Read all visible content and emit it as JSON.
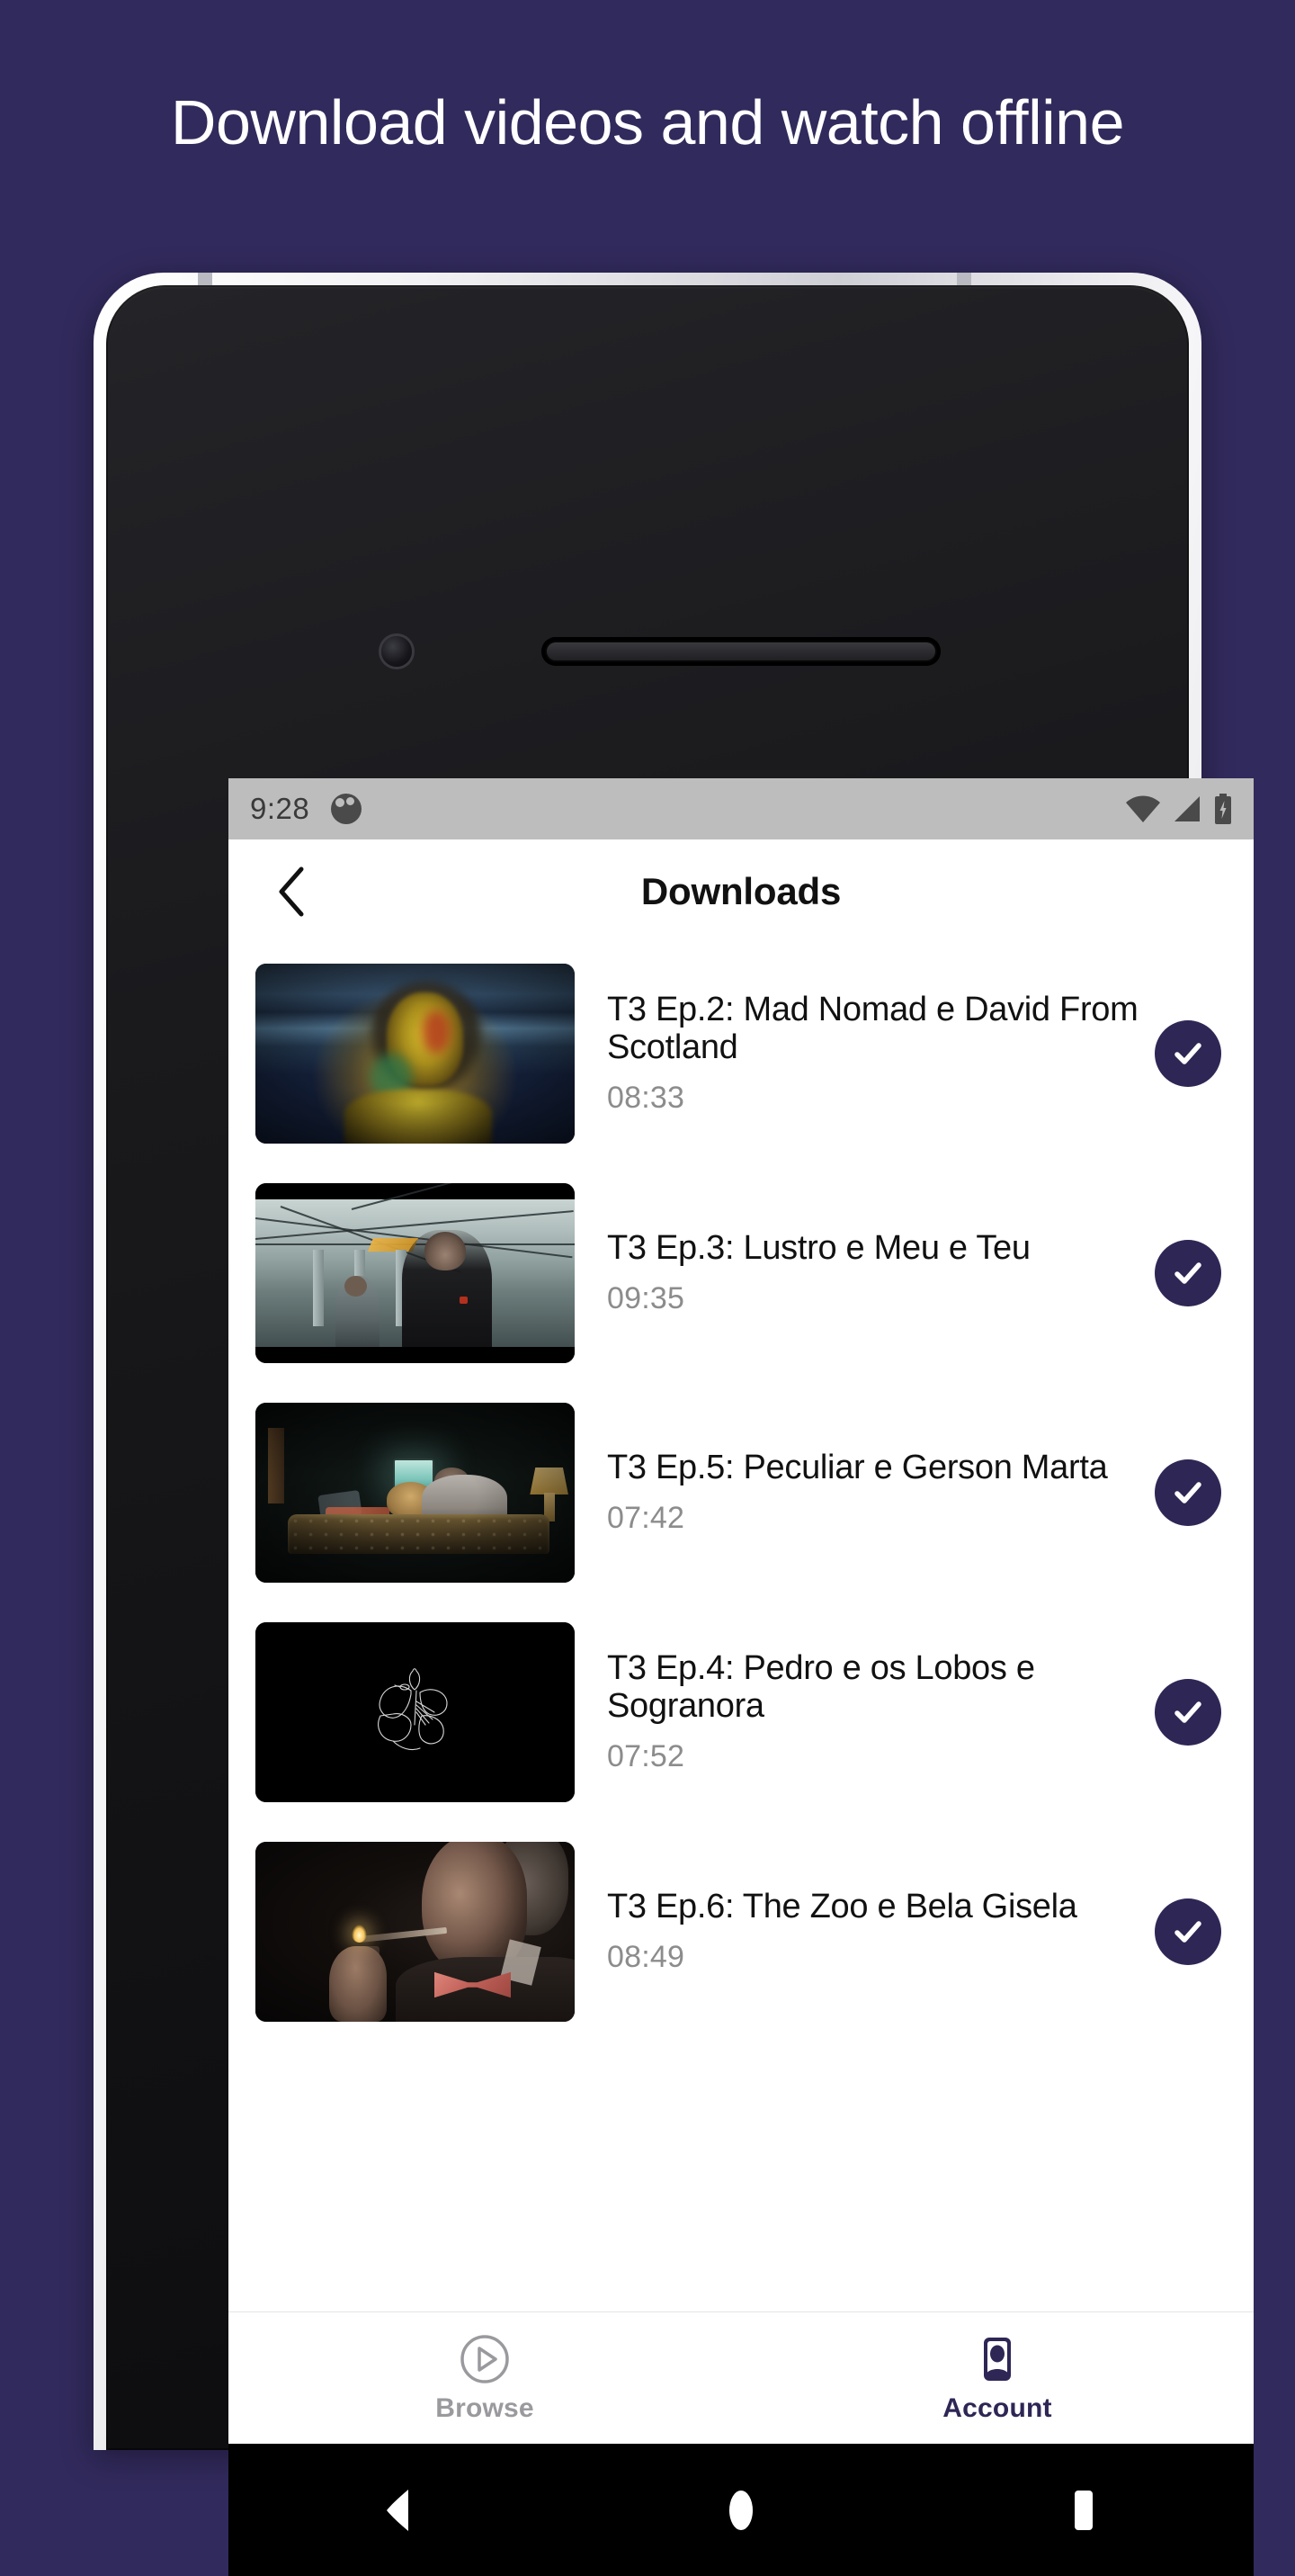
{
  "promo": {
    "headline": "Download videos and watch offline",
    "background_color": "#312a5c"
  },
  "theme": {
    "accent_color": "#2e2655",
    "screen_background": "#ffffff",
    "muted_text_color": "#8c8c8c"
  },
  "device": {
    "status_bar": {
      "time": "9:28",
      "notification_icon": "app-notification-icon",
      "wifi_icon": "wifi-icon",
      "signal_icon": "cellular-signal-icon",
      "battery_icon": "battery-charging-icon"
    },
    "navigation_bar": {
      "back": "back-triangle-key",
      "home": "home-circle-key",
      "recents": "recents-square-key"
    },
    "hardware": {
      "front_camera": "front-camera",
      "earpiece": "earpiece-speaker",
      "power_button": "power-button",
      "volume_button": "volume-rocker-button"
    }
  },
  "app_bar": {
    "back_icon": "chevron-left-icon",
    "title": "Downloads"
  },
  "downloads": [
    {
      "title": "T3 Ep.2: Mad Nomad e David From Scotland",
      "duration": "08:33",
      "thumbnail": "paint-covered-person-stadium",
      "status_icon": "check-circle-icon",
      "downloaded": true
    },
    {
      "title": "T3 Ep.3: Lustro e Meu e Teu",
      "duration": "09:35",
      "thumbnail": "man-in-warehouse",
      "status_icon": "check-circle-icon",
      "downloaded": true
    },
    {
      "title": "T3 Ep.5: Peculiar e Gerson Marta",
      "duration": "07:42",
      "thumbnail": "couple-on-couch-dark-room",
      "status_icon": "check-circle-icon",
      "downloaded": true
    },
    {
      "title": "T3 Ep.4: Pedro e os Lobos e Sogranora",
      "duration": "07:52",
      "thumbnail": "line-art-flower-on-black",
      "status_icon": "check-circle-icon",
      "downloaded": true
    },
    {
      "title": "T3 Ep.6: The Zoo e Bela Gisela",
      "duration": "08:49",
      "thumbnail": "man-lighting-cigarette",
      "status_icon": "check-circle-icon",
      "downloaded": true
    }
  ],
  "bottom_tabs": [
    {
      "label": "Browse",
      "icon": "play-circle-icon",
      "active": false
    },
    {
      "label": "Account",
      "icon": "account-badge-icon",
      "active": true
    }
  ]
}
